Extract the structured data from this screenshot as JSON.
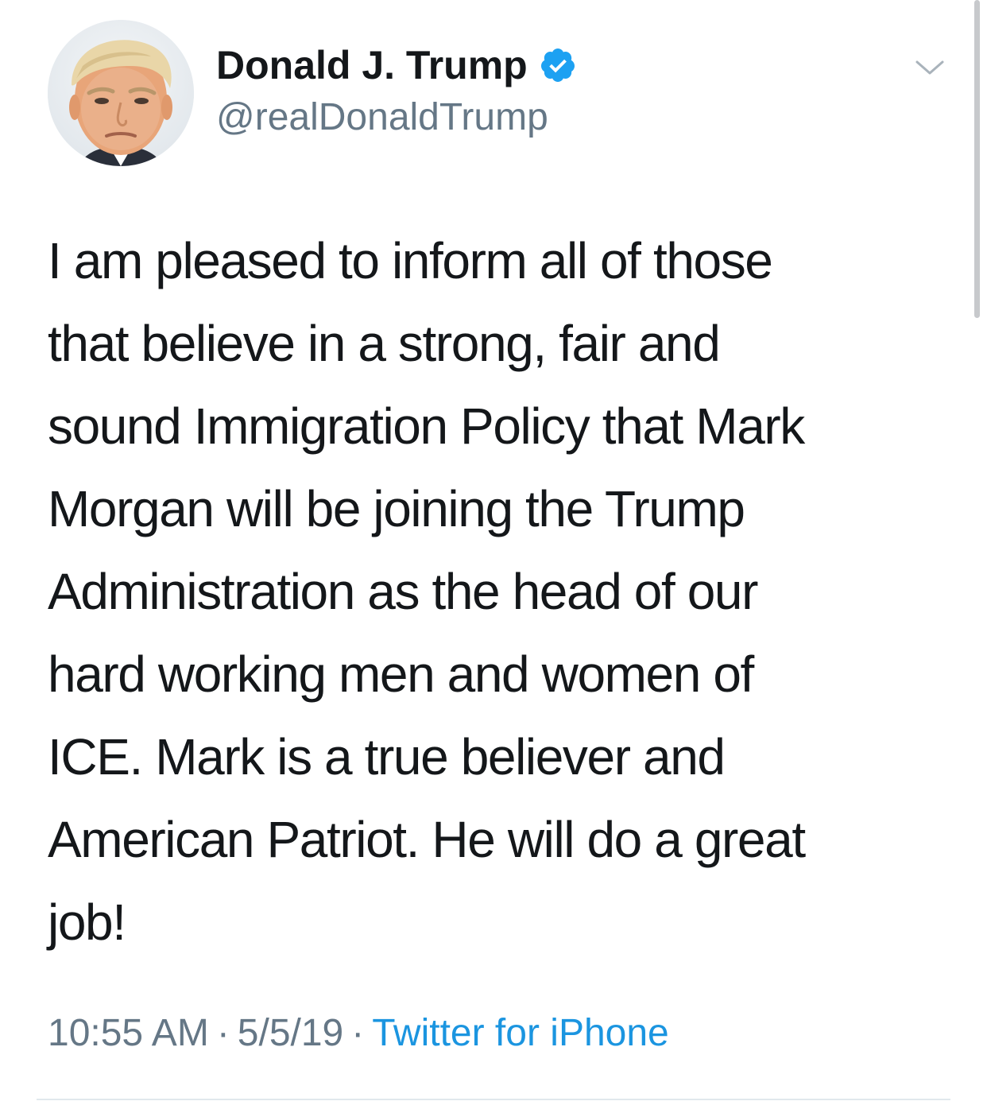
{
  "tweet": {
    "author": {
      "display_name": "Donald J. Trump",
      "handle": "@realDonaldTrump",
      "verified": true,
      "verified_icon": "verified-badge-icon",
      "avatar": "profile-photo"
    },
    "menu_icon": "chevron-down-icon",
    "text_lines": [
      "I am pleased to inform all of those",
      "that believe in a strong, fair and",
      "sound Immigration Policy that Mark",
      "Morgan will be joining the Trump",
      "Administration as the head of our",
      "hard working men and women of",
      "ICE. Mark is a true believer and",
      "American Patriot. He will do a great",
      "job!"
    ],
    "meta": {
      "time": "10:55 AM",
      "separator": "·",
      "date": "5/5/19",
      "source": "Twitter for iPhone"
    }
  },
  "colors": {
    "primary_text": "#14171a",
    "secondary_text": "#657786",
    "link": "#1b95e0",
    "verified": "#1da1f2",
    "divider": "#e1e8ed"
  }
}
